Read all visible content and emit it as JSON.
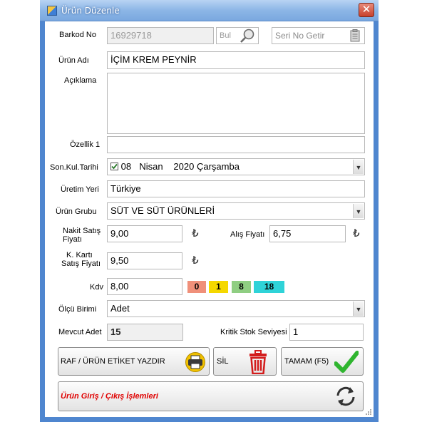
{
  "window": {
    "title": "Ürün Düzenle",
    "close_glyph": "✕"
  },
  "barkod": {
    "label": "Barkod No",
    "value": "16929718",
    "search_label": "Bul",
    "serial_button": "Seri No Getir"
  },
  "urun_adi": {
    "label": "Ürün Adı",
    "value": "İÇİM KREM PEYNİR"
  },
  "aciklama": {
    "label": "Açıklama",
    "value": ""
  },
  "ozellik1": {
    "label": "Özellik 1",
    "value": ""
  },
  "son_kul": {
    "label": "Son.Kul.Tarihi",
    "checked": true,
    "day": "08",
    "month": "Nisan",
    "year_weekday": "2020 Çarşamba"
  },
  "uretim_yeri": {
    "label": "Üretim Yeri",
    "value": "Türkiye"
  },
  "urun_grubu": {
    "label": "Ürün Grubu",
    "value": "SÜT VE SÜT ÜRÜNLERİ"
  },
  "nakit": {
    "label_line1": "Nakit Satış",
    "label_line2": "Fiyatı",
    "value": "9,00",
    "currency": "₺"
  },
  "alis": {
    "label": "Alış Fiyatı",
    "value": "6,75",
    "currency": "₺"
  },
  "kkarti": {
    "label_line1": "K. Kartı",
    "label_line2": "Satış Fiyatı",
    "value": "9,50",
    "currency": "₺"
  },
  "kdv": {
    "label": "Kdv",
    "value": "8,00",
    "chips": [
      {
        "label": "0",
        "color": "#f0907a"
      },
      {
        "label": "1",
        "color": "#f5d800"
      },
      {
        "label": "8",
        "color": "#8fce82"
      },
      {
        "label": "18",
        "color": "#2fd3d8"
      }
    ]
  },
  "olcu": {
    "label": "Ölçü Birimi",
    "value": "Adet"
  },
  "mevcut": {
    "label": "Mevcut Adet",
    "value": "15"
  },
  "kritik": {
    "label": "Kritik Stok Seviyesi",
    "value": "1"
  },
  "buttons": {
    "raf": "RAF / ÜRÜN ETİKET YAZDIR",
    "sil": "SİL",
    "tamam": "TAMAM (F5)",
    "giris_cikis": "Ürün Giriş / Çıkış İşlemleri"
  },
  "colors": {
    "title_bar": "#8cb6e6",
    "frame": "#4f86cf",
    "alert_text": "#e00000",
    "check_green": "#2fb52f",
    "trash_red": "#d31c1c"
  }
}
